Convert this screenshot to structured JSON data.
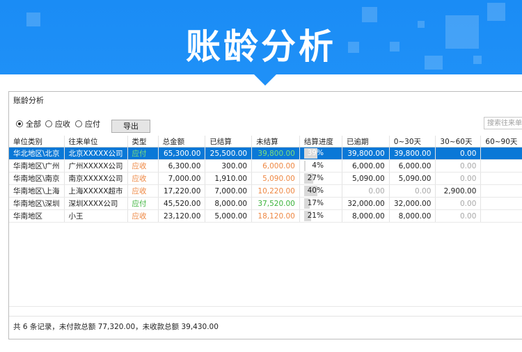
{
  "banner": {
    "title": "账龄分析",
    "color": "#1f90f7"
  },
  "window": {
    "title": "账龄分析"
  },
  "filters": {
    "options": [
      {
        "label": "全部",
        "checked": true
      },
      {
        "label": "应收",
        "checked": false
      },
      {
        "label": "应付",
        "checked": false
      }
    ],
    "export_label": "导出",
    "search_placeholder": "搜索往来单位"
  },
  "table": {
    "columns": [
      "单位类别",
      "往来单位",
      "类型",
      "总金额",
      "已结算",
      "未结算",
      "结算进度",
      "已逾期",
      "0~30天",
      "30~60天",
      "60~90天"
    ],
    "rows": [
      {
        "category": "华北地区\\北京",
        "unit": "北京XXXXX公司",
        "type": "应付",
        "total": "65,300.00",
        "settled": "25,500.00",
        "unsettled": "39,800.00",
        "progress_label": "39%",
        "progress": 0.39,
        "overdue": "39,800.00",
        "d0_30": "39,800.00",
        "d30_60": "0.00",
        "d60_90": ""
      },
      {
        "category": "华南地区\\广州",
        "unit": "广州XXXXX公司",
        "type": "应收",
        "total": "6,300.00",
        "settled": "300.00",
        "unsettled": "6,000.00",
        "progress_label": "4%",
        "progress": 0.04,
        "overdue": "6,000.00",
        "d0_30": "6,000.00",
        "d30_60": "0.00",
        "d60_90": ""
      },
      {
        "category": "华南地区\\南京",
        "unit": "南京XXXXX公司",
        "type": "应收",
        "total": "7,000.00",
        "settled": "1,910.00",
        "unsettled": "5,090.00",
        "progress_label": "27%",
        "progress": 0.27,
        "overdue": "5,090.00",
        "d0_30": "5,090.00",
        "d30_60": "0.00",
        "d60_90": ""
      },
      {
        "category": "华南地区\\上海",
        "unit": "上海XXXXX超市",
        "type": "应收",
        "total": "17,220.00",
        "settled": "7,000.00",
        "unsettled": "10,220.00",
        "progress_label": "40%",
        "progress": 0.4,
        "overdue": "0.00",
        "d0_30": "0.00",
        "d30_60": "2,900.00",
        "d60_90": ""
      },
      {
        "category": "华南地区\\深圳",
        "unit": "深圳XXXX公司",
        "type": "应付",
        "total": "45,520.00",
        "settled": "8,000.00",
        "unsettled": "37,520.00",
        "progress_label": "17%",
        "progress": 0.17,
        "overdue": "32,000.00",
        "d0_30": "32,000.00",
        "d30_60": "0.00",
        "d60_90": ""
      },
      {
        "category": "华南地区",
        "unit": "小王",
        "type": "应收",
        "total": "23,120.00",
        "settled": "5,000.00",
        "unsettled": "18,120.00",
        "progress_label": "21%",
        "progress": 0.21,
        "overdue": "8,000.00",
        "d0_30": "8,000.00",
        "d30_60": "0.00",
        "d60_90": ""
      }
    ]
  },
  "status": {
    "text": "共 6 条记录，未付款总额 77,320.00，未收款总额 39,430.00"
  }
}
